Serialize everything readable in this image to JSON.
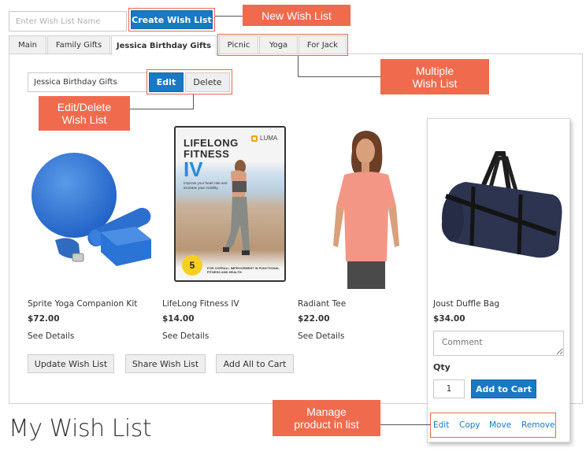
{
  "create_form": {
    "name_placeholder": "Enter Wish List Name",
    "create_button": "Create Wish List"
  },
  "annotations": {
    "new_wish_list": "New Wish List",
    "multiple_wish_list_line1": "Multiple",
    "multiple_wish_list_line2": "Wish List",
    "edit_delete_line1": "Edit/Delete",
    "edit_delete_line2": "Wish List",
    "manage_line1": "Manage",
    "manage_line2": "product in list",
    "color": "#f06b4d"
  },
  "tabs": [
    {
      "label": "Main",
      "active": false
    },
    {
      "label": "Family Gifts",
      "active": false
    },
    {
      "label": "Jessica Birthday Gifts",
      "active": true
    },
    {
      "label": "Picnic",
      "active": false
    },
    {
      "label": "Yoga",
      "active": false
    },
    {
      "label": "For Jack",
      "active": false
    }
  ],
  "list_editor": {
    "name_value": "Jessica Birthday Gifts",
    "edit_button": "Edit",
    "delete_button": "Delete"
  },
  "products": [
    {
      "name": "Sprite Yoga Companion Kit",
      "price": "$72.00",
      "details_link": "See Details",
      "image": "yoga-kit-image"
    },
    {
      "name": "LifeLong Fitness IV",
      "price": "$14.00",
      "details_link": "See Details",
      "image": "fitness-dvd-image",
      "dvd": {
        "title1": "LIFELONG",
        "title2": "FITNESS",
        "title3": "IV",
        "brand": "LUMA",
        "tagline": "Improve your heart rate and increase your mobility.",
        "badge_number": "5",
        "footer": "FOR OVERALL IMPROVEMENT IN FUNCTIONAL FITNESS AND HEALTH."
      }
    },
    {
      "name": "Radiant Tee",
      "price": "$22.00",
      "details_link": "See Details",
      "image": "radiant-tee-image"
    },
    {
      "name": "Joust Duffle Bag",
      "price": "$34.00",
      "image": "duffle-bag-image",
      "comment_placeholder": "Comment",
      "qty_label": "Qty",
      "qty_value": "1",
      "add_to_cart": "Add to Cart",
      "actions": [
        "Edit",
        "Copy",
        "Move",
        "Remove"
      ]
    }
  ],
  "bottom_actions": {
    "update": "Update Wish List",
    "share": "Share Wish List",
    "add_all": "Add All to Cart"
  },
  "page_title": "My Wish List",
  "colors": {
    "primary": "#1979c3",
    "link": "#1979c3",
    "annotation": "#f06b4d"
  }
}
